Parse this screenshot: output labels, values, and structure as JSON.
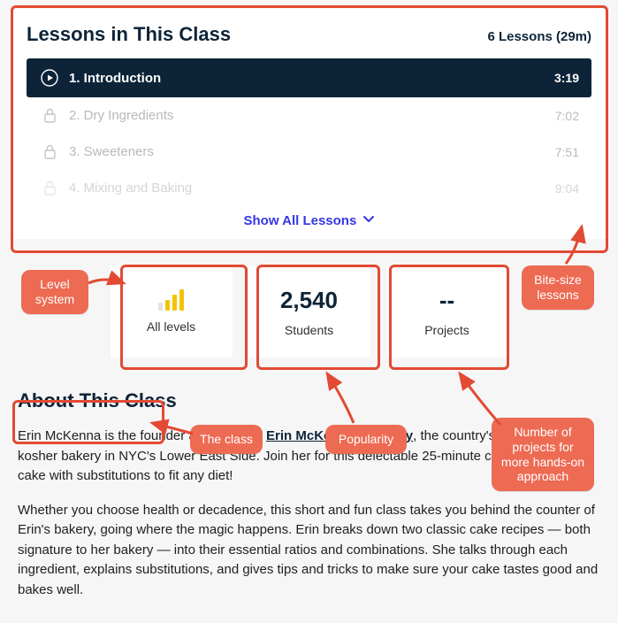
{
  "lessons": {
    "title": "Lessons in This Class",
    "count_label": "6 Lessons (29m)",
    "items": [
      {
        "title": "1. Introduction",
        "duration": "3:19",
        "state": "active"
      },
      {
        "title": "2. Dry Ingredients",
        "duration": "7:02",
        "state": "locked"
      },
      {
        "title": "3. Sweeteners",
        "duration": "7:51",
        "state": "locked"
      },
      {
        "title": "4. Mixing and Baking",
        "duration": "9:04",
        "state": "locked-faded"
      }
    ],
    "show_all": "Show All Lessons"
  },
  "stats": {
    "level": {
      "label": "All levels"
    },
    "students": {
      "value": "2,540",
      "label": "Students"
    },
    "projects": {
      "value": "--",
      "label": "Projects"
    }
  },
  "about": {
    "title": "About This Class",
    "p1_a": "Erin McKenna is the founder and baker at ",
    "p1_link": "Erin McKenna's Bakery",
    "p1_b": ", the country's leadin",
    "p1_c": "kosher bakery in NYC's Lower East Side. Join her for this delectable 25-minute class on l",
    "p1_d": "cake with substitutions to fit any diet!",
    "p2": "Whether you choose health or decadence, this short and fun class takes you behind the counter of Erin's bakery, going where the magic happens. Erin breaks down two classic cake recipes — both signature to her bakery — into their essential ratios and combinations. She talks through each ingredient, explains substitutions, and gives tips and tricks to make sure your cake tastes good and bakes well."
  },
  "annotations": {
    "level": "Level system",
    "bite": "Bite-size lessons",
    "class": "The class",
    "popularity": "Popularity",
    "projects": "Number of projects for more hands-on approach"
  }
}
